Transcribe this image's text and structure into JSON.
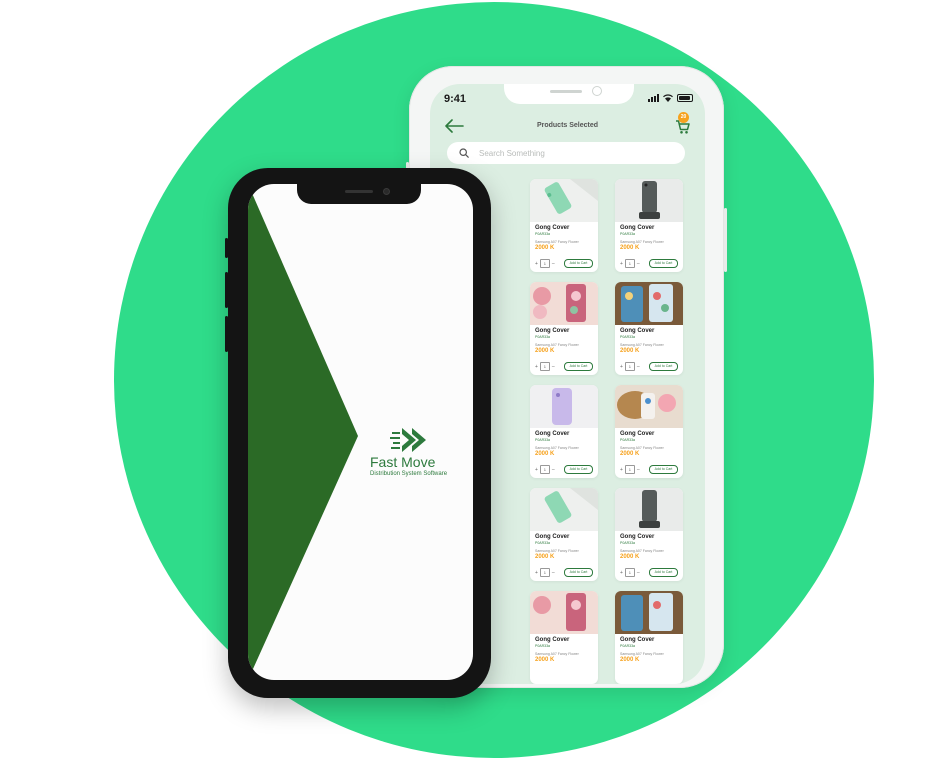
{
  "back_phone": {
    "status_time": "9:41",
    "header_title": "Products Selected",
    "cart_count": "20",
    "search_placeholder": "Search Something",
    "products": [
      {
        "name": "Gong Cover",
        "code": "P0AR33a",
        "desc": "Samsung A07 Fancy Flower",
        "price": "2000 K",
        "qty": "1",
        "add_label": "Add to Cart"
      },
      {
        "name": "Gong Cover",
        "code": "P0AR33a",
        "desc": "Samsung A07 Fancy Flower",
        "price": "2000 K",
        "qty": "1",
        "add_label": "Add to Cart"
      },
      {
        "name": "Gong Cover",
        "code": "P0AR33a",
        "desc": "Samsung A07 Fancy Flower",
        "price": "2000 K",
        "qty": "1",
        "add_label": "Add to Cart"
      },
      {
        "name": "Gong Cover",
        "code": "P0AR33a",
        "desc": "Samsung A07 Fancy Flower",
        "price": "2000 K",
        "qty": "1",
        "add_label": "Add to Cart"
      },
      {
        "name": "Gong Cover",
        "code": "P0AR33a",
        "desc": "Samsung A07 Fancy Flower",
        "price": "2000 K",
        "qty": "1",
        "add_label": "Add to Cart"
      },
      {
        "name": "Gong Cover",
        "code": "P0AR33a",
        "desc": "Samsung A07 Fancy Flower",
        "price": "2000 K",
        "qty": "1",
        "add_label": "Add to Cart"
      },
      {
        "name": "Gong Cover",
        "code": "P0AR33a",
        "desc": "Samsung A07 Fancy Flower",
        "price": "2000 K",
        "qty": "1",
        "add_label": "Add to Cart"
      },
      {
        "name": "Gong Cover",
        "code": "P0AR33a",
        "desc": "Samsung A07 Fancy Flower",
        "price": "2000 K",
        "qty": "1",
        "add_label": "Add to Cart"
      },
      {
        "name": "Gong Cover",
        "code": "P0AR33a",
        "desc": "Samsung A07 Fancy Flower",
        "price": "2000 K",
        "qty": "1",
        "add_label": "Add to Cart"
      },
      {
        "name": "Gong Cover",
        "code": "P0AR33a",
        "desc": "Samsung A07 Fancy Flower",
        "price": "2000 K",
        "qty": "1",
        "add_label": "Add to Cart"
      }
    ]
  },
  "front_phone": {
    "brand_name": "Fast Move",
    "brand_tagline": "Distribution System Software"
  },
  "colors": {
    "background_circle": "#2fdc8a",
    "brand_green": "#2d7a3d",
    "dark_green": "#2b6a26",
    "price_orange": "#f6a21e"
  }
}
